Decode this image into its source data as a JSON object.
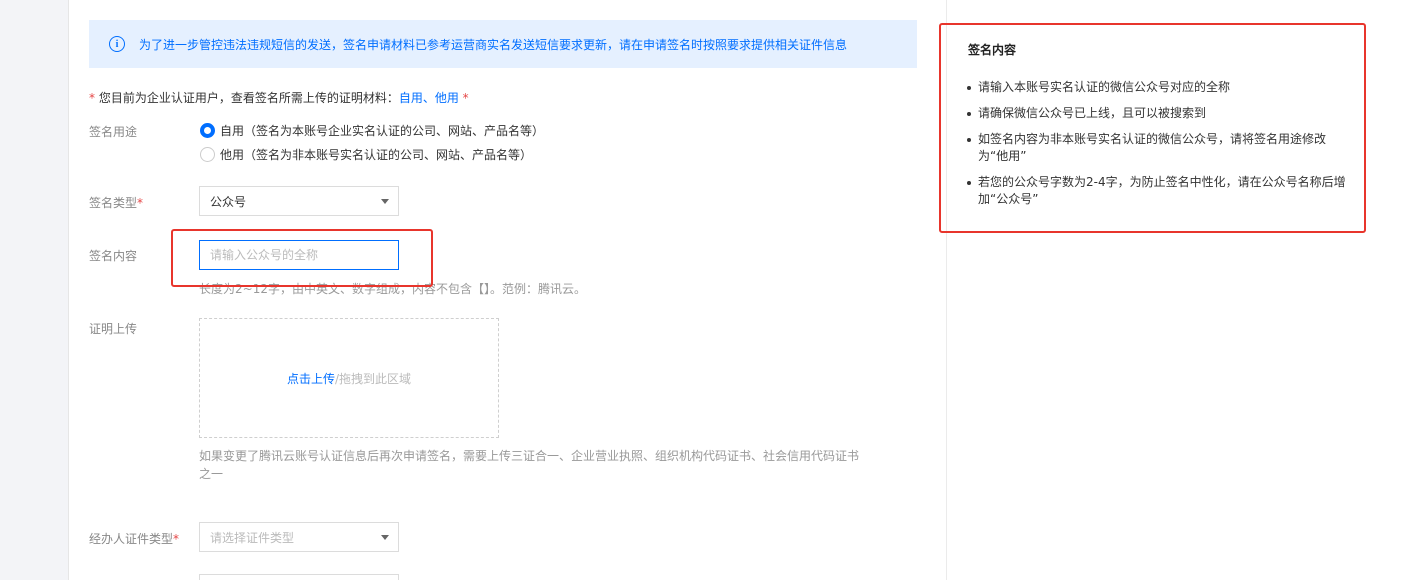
{
  "banner": {
    "icon": "info-icon",
    "text": "为了进一步管控违法违规短信的发送，签名申请材料已参考运营商实名发送短信要求更新，请在申请签名时按照要求提供相关证件信息"
  },
  "notice": {
    "asterisk": "*",
    "text": " 您目前为企业认证用户，查看签名所需上传的证明材料：",
    "link": "自用、他用",
    "asterisk_end": " *"
  },
  "form": {
    "usage": {
      "label": "签名用途",
      "options": [
        {
          "label": "自用（签名为本账号企业实名认证的公司、网站、产品名等）",
          "checked": true
        },
        {
          "label": "他用（签名为非本账号实名认证的公司、网站、产品名等）",
          "checked": false
        }
      ]
    },
    "type": {
      "label": "签名类型",
      "required": "*",
      "value": "公众号"
    },
    "content": {
      "label": "签名内容",
      "placeholder": "请输入公众号的全称",
      "hint": "长度为2~12字，由中英文、数字组成，内容不包含【】。范例：腾讯云。"
    },
    "proof": {
      "label": "证明上传",
      "upload_link": "点击上传",
      "upload_rest": "/拖拽到此区域",
      "hint": "如果变更了腾讯云账号认证信息后再次申请签名，需要上传三证合一、企业营业执照、组织机构代码证书、社会信用代码证书之一"
    },
    "agent_id_type": {
      "label": "经办人证件类型",
      "required": "*",
      "placeholder": "请选择证件类型"
    }
  },
  "tips": {
    "title": "签名内容",
    "items": [
      "请输入本账号实名认证的微信公众号对应的全称",
      "请确保微信公众号已上线，且可以被搜索到",
      "如签名内容为非本账号实名认证的微信公众号，请将签名用途修改为“他用”",
      "若您的公众号字数为2-4字，为防止签名中性化，请在公众号名称后增加“公众号”"
    ]
  },
  "colors": {
    "accent": "#006eff",
    "required": "#e54545",
    "highlight": "#e8352c",
    "banner_bg": "#e5f0ff"
  }
}
